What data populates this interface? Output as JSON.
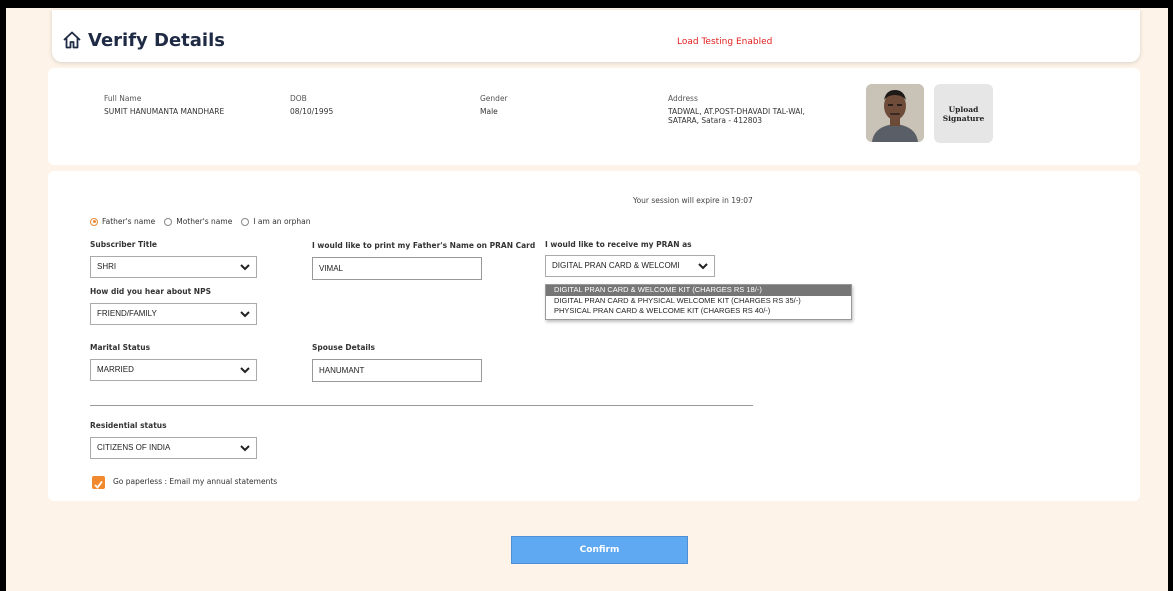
{
  "header": {
    "title": "Verify Details",
    "load_testing": "Load Testing Enabled"
  },
  "subscriber": {
    "full_name_label": "Full Name",
    "full_name": "SUMIT HANUMANTA MANDHARE",
    "dob_label": "DOB",
    "dob": "08/10/1995",
    "gender_label": "Gender",
    "gender": "Male",
    "address_label": "Address",
    "address_line1": "TADWAL, AT.POST-DHAVADI TAL-WAI,",
    "address_line2": "SATARA, Satara - 412803",
    "upload_signature_line1": "Upload",
    "upload_signature_line2": "Signature"
  },
  "form": {
    "session_text": "Your session will expire in 19:07",
    "name_options": [
      {
        "label": "Father's name",
        "selected": true
      },
      {
        "label": "Mother's name",
        "selected": false
      },
      {
        "label": "I am an orphan",
        "selected": false
      }
    ],
    "subscriber_title_label": "Subscriber Title",
    "subscriber_title_value": "SHRI",
    "print_name_label": "I would like to print my Father's Name on PRAN Card",
    "print_name_value": "VIMAL",
    "receive_pran_label": "I would like to receive my PRAN as",
    "receive_pran_value": "DIGITAL PRAN CARD & WELCOMI",
    "receive_pran_options": [
      "DIGITAL PRAN CARD & WELCOME KIT (CHARGES RS 18/-)",
      "DIGITAL PRAN CARD & PHYSICAL WELCOME KIT (CHARGES RS 35/-)",
      "PHYSICAL PRAN CARD & WELCOME KIT (CHARGES RS 40/-)"
    ],
    "hear_about_label": "How did you hear about NPS",
    "hear_about_value": "FRIEND/FAMILY",
    "marital_label": "Marital Status",
    "marital_value": "MARRIED",
    "spouse_label": "Spouse Details",
    "spouse_value": "HANUMANT",
    "residential_label": "Residential status",
    "residential_value": "CITIZENS OF INDIA",
    "paperless_label": "Go paperless : Email my annual statements",
    "paperless_checked": true
  },
  "confirm_label": "Confirm",
  "colors": {
    "accent_orange": "#f18a2f",
    "alert_red": "#e02020",
    "button_blue": "#5fa8f2",
    "page_bg": "#fdf3e9"
  }
}
